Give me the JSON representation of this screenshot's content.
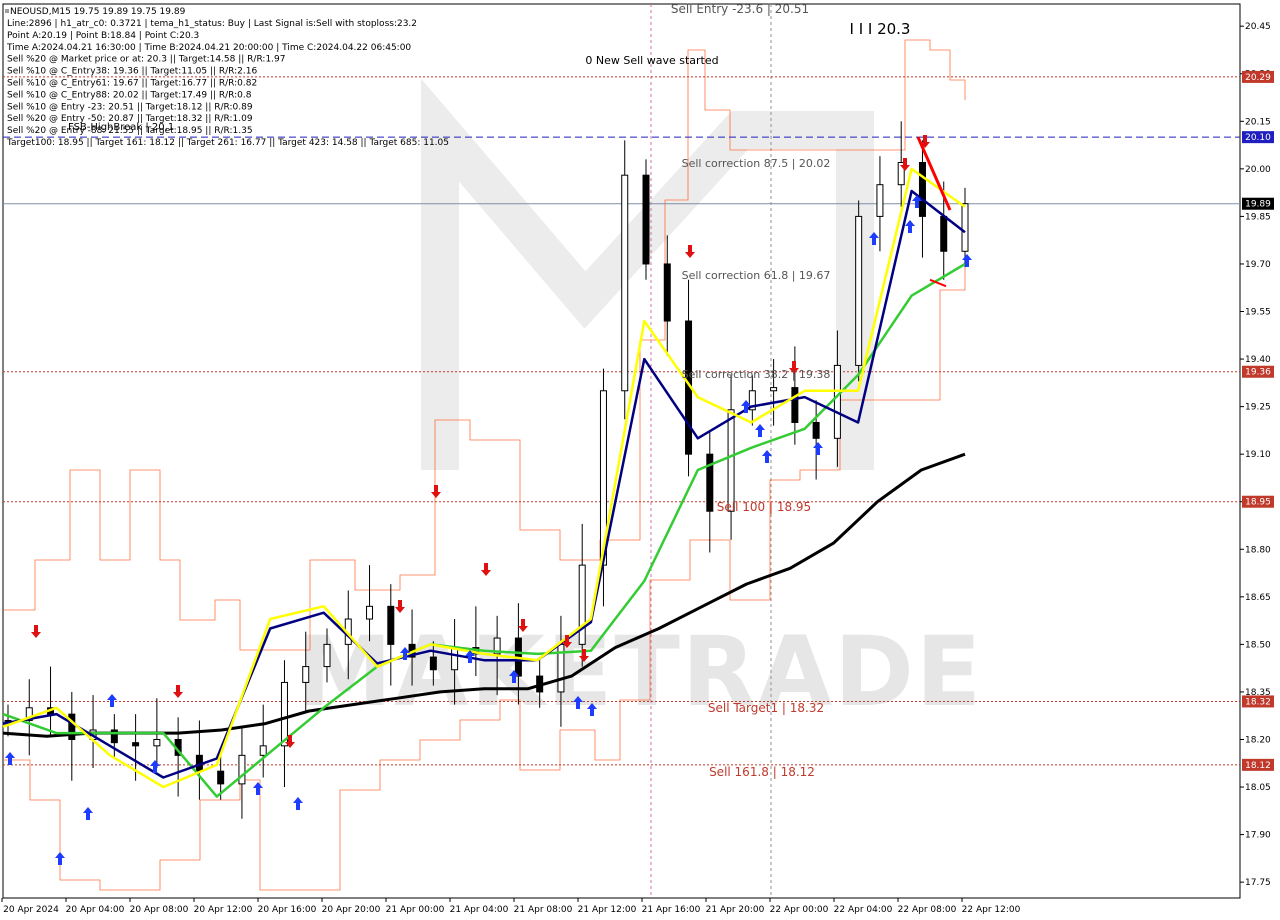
{
  "chart_data": {
    "type": "line",
    "title": "NEOUSD,M15  19.75 19.89 19.75 19.89",
    "info_lines": [
      "Line:2896 | h1_atr_c0: 0.3721 | tema_h1_status: Buy | Last Signal is:Sell with stoploss:23.2",
      "Point A:20.19 | Point B:18.84 | Point C:20.3",
      "Time A:2024.04.21 16:30:00 | Time B:2024.04.21 20:00:00 | Time C:2024.04.22 06:45:00",
      "Sell %20 @ Market price or at: 20.3 || Target:14.58 || R/R:1.97",
      "Sell %10 @ C_Entry38: 19.36 || Target:11.05 || R/R:2.16",
      "Sell %10 @ C_Entry61: 19.67 || Target:16.77 || R/R:0.82",
      "Sell %10 @ C_Entry88: 20.02 || Target:17.49 || R/R:0.8",
      "Sell %10 @ Entry -23: 20.51 || Target:18.12 || R/R:0.89",
      "Sell %20 @ Entry -50: 20.87 || Target:18.32 || R/R:1.09",
      "Sell %20 @ Entry -88: 21.55 || Target:18.95 || R/R:1.35",
      "Target100: 18.95 || Target 161: 18.12 || Target 261: 16.77 || Target 423: 14.58 || Target 685: 11.05"
    ],
    "y_ticks": [
      "20.45",
      "20.30",
      "20.15",
      "20.00",
      "19.85",
      "19.70",
      "19.55",
      "19.40",
      "19.25",
      "19.10",
      "18.95",
      "18.80",
      "18.65",
      "18.50",
      "18.35",
      "18.20",
      "18.05",
      "17.90",
      "17.75"
    ],
    "y_range": [
      17.7,
      20.52
    ],
    "x_ticks": [
      "20 Apr 2024",
      "20 Apr 04:00",
      "20 Apr 08:00",
      "20 Apr 12:00",
      "20 Apr 16:00",
      "20 Apr 20:00",
      "21 Apr 00:00",
      "21 Apr 04:00",
      "21 Apr 08:00",
      "21 Apr 12:00",
      "21 Apr 16:00",
      "21 Apr 20:00",
      "22 Apr 00:00",
      "22 Apr 04:00",
      "22 Apr 08:00",
      "22 Apr 12:00"
    ],
    "current_price": "19.89",
    "levels": [
      {
        "label": "Sell Entry -23.6 | 20.51",
        "value": 20.51,
        "tag": "",
        "style": "none",
        "color": "#555555"
      },
      {
        "label": "",
        "value": 20.29,
        "tag": "20.29",
        "style": "dotted",
        "color": "#c0392b"
      },
      {
        "label": "",
        "value": 20.1,
        "tag": "20.10",
        "style": "dashed",
        "color": "#1f1fbf"
      },
      {
        "label": "Sell correction 87.5 | 20.02",
        "value": 20.02,
        "tag": "",
        "style": "none",
        "color": "#555555"
      },
      {
        "label": "Sell correction 61.8 | 19.67",
        "value": 19.67,
        "tag": "",
        "style": "none",
        "color": "#555555"
      },
      {
        "label": "Sell correction 38.2 | 19.38",
        "value": 19.36,
        "tag": "19.36",
        "style": "dotted",
        "color": "#c0392b"
      },
      {
        "label": "Sell 100 | 18.95",
        "value": 18.95,
        "tag": "18.95",
        "style": "dotted",
        "color": "#c0392b"
      },
      {
        "label": "Sell Target1 | 18.32",
        "value": 18.32,
        "tag": "18.32",
        "style": "dotted",
        "color": "#c0392b"
      },
      {
        "label": "Sell 161.8 | 18.12",
        "value": 18.12,
        "tag": "18.12",
        "style": "dotted",
        "color": "#c0392b"
      }
    ],
    "annotations": {
      "wave_label": "I I I 20.3",
      "new_wave": "0 New Sell wave started",
      "fsb": "FSB-HighBreak | 20.1"
    },
    "watermark": "MAKETRADE",
    "series": [
      {
        "name": "",
        "color": "#000000",
        "values": [
          18.22,
          18.21,
          18.22,
          18.22,
          18.22,
          18.23,
          18.25,
          18.29,
          18.31,
          18.33,
          18.35,
          18.36,
          18.36,
          18.4,
          18.49,
          18.55,
          18.62,
          18.69,
          18.74,
          18.82,
          18.95,
          19.05,
          19.1
        ]
      },
      {
        "name": "",
        "color": "#33cc33",
        "values": [
          18.28,
          18.22,
          18.22,
          18.22,
          18.02,
          18.16,
          18.3,
          18.43,
          18.5,
          18.48,
          18.47,
          18.48,
          18.7,
          19.05,
          19.12,
          19.18,
          19.35,
          19.6,
          19.7
        ]
      },
      {
        "name": "",
        "color": "#000080",
        "values": [
          18.25,
          18.28,
          18.18,
          18.08,
          18.14,
          18.55,
          18.6,
          18.44,
          18.48,
          18.45,
          18.45,
          18.57,
          19.4,
          19.15,
          19.25,
          19.28,
          19.2,
          19.93,
          19.8
        ]
      },
      {
        "name": "",
        "color": "#ffff00",
        "values": [
          18.24,
          18.3,
          18.15,
          18.05,
          18.12,
          18.58,
          18.62,
          18.43,
          18.5,
          18.47,
          18.45,
          18.58,
          19.52,
          19.28,
          19.2,
          19.3,
          19.3,
          20.0,
          19.88
        ]
      }
    ],
    "candles_close": [
      18.26,
      18.3,
      18.28,
      18.2,
      18.23,
      18.19,
      18.18,
      18.2,
      18.15,
      18.1,
      18.06,
      18.15,
      18.18,
      18.38,
      18.43,
      18.5,
      18.58,
      18.62,
      18.5,
      18.46,
      18.42,
      18.49,
      18.47,
      18.52,
      18.4,
      18.35,
      18.5,
      18.75,
      19.3,
      19.98,
      19.7,
      19.52,
      19.1,
      18.92,
      19.24,
      19.3,
      19.31,
      19.2,
      19.15,
      19.38,
      19.85,
      19.95,
      20.02,
      19.85,
      19.74,
      19.89
    ]
  },
  "colors": {
    "accent_red": "#c0392b",
    "accent_blue": "#1f1fbf",
    "atr_orange": "#ff4500",
    "up_arrow": "#1e3cff",
    "down_arrow": "#e01010"
  }
}
